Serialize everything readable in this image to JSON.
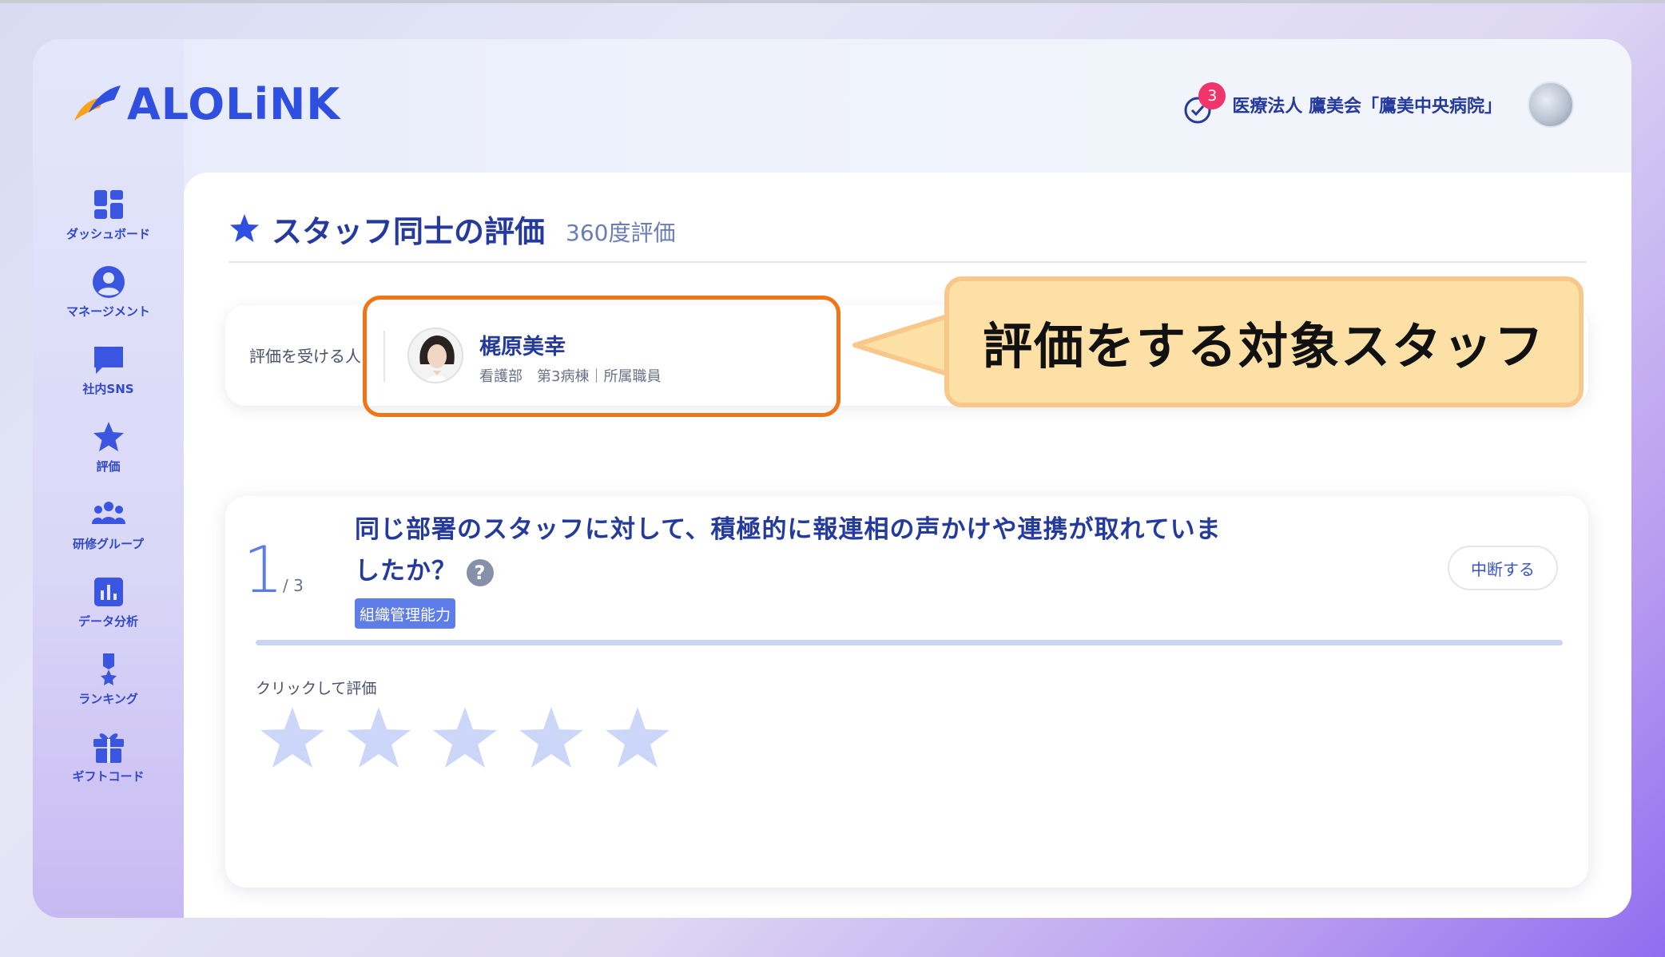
{
  "brand": {
    "name": "ALOLiNK",
    "accent": "#2f4fe0"
  },
  "header": {
    "notification_count": "3",
    "organization": "医療法人 鷹美会「鷹美中央病院」"
  },
  "sidebar": {
    "items": [
      {
        "label": "ダッシュボード",
        "icon": "dashboard-icon"
      },
      {
        "label": "マネージメント",
        "icon": "user-circle-icon"
      },
      {
        "label": "社内SNS",
        "icon": "chat-icon"
      },
      {
        "label": "評価",
        "icon": "star-icon"
      },
      {
        "label": "研修グループ",
        "icon": "group-icon"
      },
      {
        "label": "データ分析",
        "icon": "bar-chart-icon"
      },
      {
        "label": "ランキング",
        "icon": "medal-icon"
      },
      {
        "label": "ギフトコード",
        "icon": "gift-icon"
      }
    ]
  },
  "page": {
    "title": "スタッフ同士の評価",
    "subtitle": "360度評価"
  },
  "target": {
    "label": "評価を受ける人",
    "name": "梶原美幸",
    "info": "看護部　第3病棟｜所属職員"
  },
  "callout": {
    "text": "評価をする対象スタッフ"
  },
  "question": {
    "number": "1",
    "total": "/ 3",
    "text": "同じ部署のスタッフに対して、積極的に報連相の声かけや連携が取れていましたか？",
    "tag": "組織管理能力",
    "pause_label": "中断する",
    "rate_label": "クリックして評価",
    "stars_total": 5,
    "stars_selected": 0
  }
}
